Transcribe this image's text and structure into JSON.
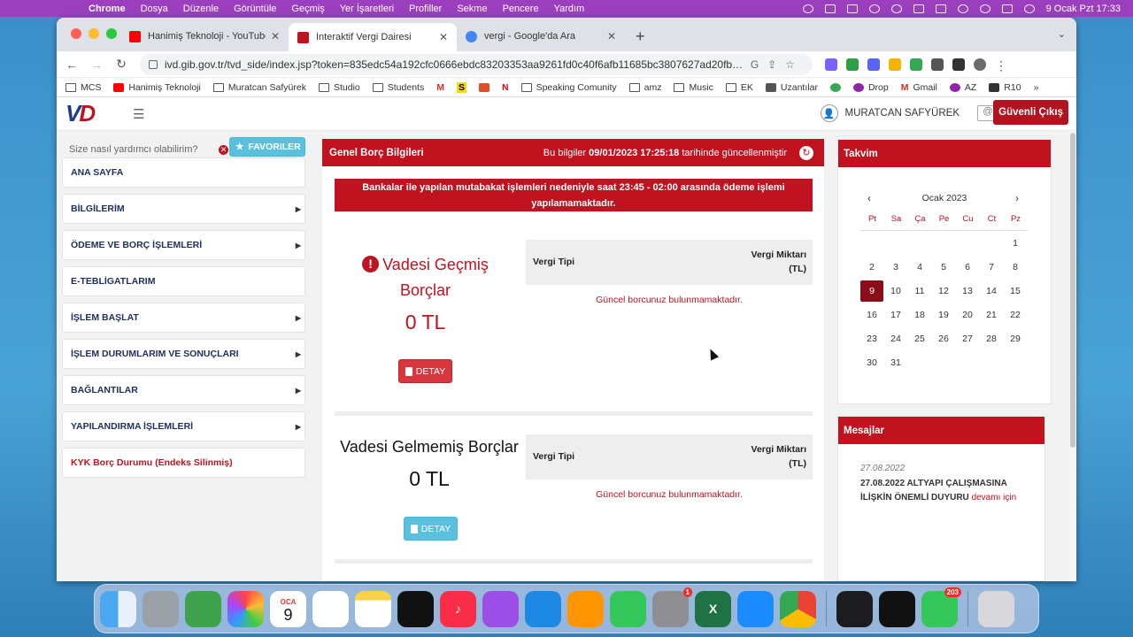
{
  "menubar": {
    "app": "Chrome",
    "items": [
      "Dosya",
      "Düzenle",
      "Görüntüle",
      "Geçmiş",
      "Yer İşaretleri",
      "Profiller",
      "Sekme",
      "Pencere",
      "Yardım"
    ],
    "clock": "9 Ocak Pzt  17:33"
  },
  "tabs": [
    {
      "title": "Hanimiş Teknoloji - YouTube",
      "color": "#ff0000"
    },
    {
      "title": "İnteraktif Vergi Dairesi",
      "color": "#c1121f"
    },
    {
      "title": "vergi - Google'da Ara",
      "color": "#4285f4"
    }
  ],
  "address": {
    "url": "ivd.gib.gov.tr/tvd_side/index.jsp?token=835edc54a192cfc0666ebdc83203353aa9261fd0c40f6afb11685bc3807627ad20fb33bae6d5..."
  },
  "bookmarks": [
    "MCS",
    "Hanimiş Teknoloji",
    "Muratcan Safyürek",
    "Studio",
    "Students",
    "M",
    "S",
    "",
    "N",
    "Speaking Comunity",
    "amz",
    "Music",
    "EK",
    "Uzantılar",
    "",
    "Drop",
    "Gmail",
    "AZ",
    "R10"
  ],
  "header": {
    "logo_v": "V",
    "logo_d": "D",
    "user_name": "MURATCAN SAFYÜREK",
    "logout_label": "Güvenli Çıkış"
  },
  "sidebar": {
    "search_placeholder": "Size nasıl yardımcı olabilirim?",
    "favorites_label": "FAVORILER",
    "items": [
      {
        "label": "ANA SAYFA"
      },
      {
        "label": "BİLGİLERİM"
      },
      {
        "label": "ÖDEME VE BORÇ İŞLEMLERİ"
      },
      {
        "label": "E-TEBLİGATLARIM"
      },
      {
        "label": "İŞLEM BAŞLAT"
      },
      {
        "label": "İŞLEM DURUMLARIM VE SONUÇLARI"
      },
      {
        "label": "BAĞLANTILAR"
      },
      {
        "label": "YAPILANDIRMA İŞLEMLERİ"
      },
      {
        "label": "KYK Borç Durumu (Endeks Silinmiş)"
      }
    ]
  },
  "main": {
    "title": "Genel Borç Bilgileri",
    "updated_prefix": "Bu bilgiler",
    "updated_at": "09/01/2023 17:25:18",
    "updated_suffix": "tarihinde güncellenmiştir",
    "alert": "Bankalar ile yapılan mutabakat işlemleri nedeniyle saat 23:45 - 02:00 arasında ödeme işlemi yapılamamaktadır.",
    "overdue": {
      "title": "Vadesi Geçmiş Borçlar",
      "amount": "0 TL",
      "button": "DETAY",
      "col_type": "Vergi Tipi",
      "col_amount_1": "Vergi Miktarı",
      "col_amount_2": "(TL)",
      "empty": "Güncel borcunuz bulunmamaktadır."
    },
    "upcoming": {
      "title": "Vadesi Gelmemiş Borçlar",
      "amount": "0 TL",
      "button": "DETAY",
      "col_type": "Vergi Tipi",
      "col_amount_1": "Vergi Miktarı",
      "col_amount_2": "(TL)",
      "empty": "Güncel borcunuz bulunmamaktadır."
    }
  },
  "calendar": {
    "title": "Takvim",
    "month": "Ocak 2023",
    "weekdays": [
      "Pt",
      "Sa",
      "Ça",
      "Pe",
      "Cu",
      "Ct",
      "Pz"
    ],
    "today": 9
  },
  "messages": {
    "title": "Mesajlar",
    "date": "27.08.2022",
    "text": "27.08.2022 ALTYAPI ÇALIŞMASINA İLİŞKİN ÖNEMLİ DUYURU",
    "link": "devamı için"
  },
  "dock": {
    "calendar_month": "OCA",
    "calendar_day": "9",
    "settings_badge": "1",
    "messages_badge": "203"
  }
}
